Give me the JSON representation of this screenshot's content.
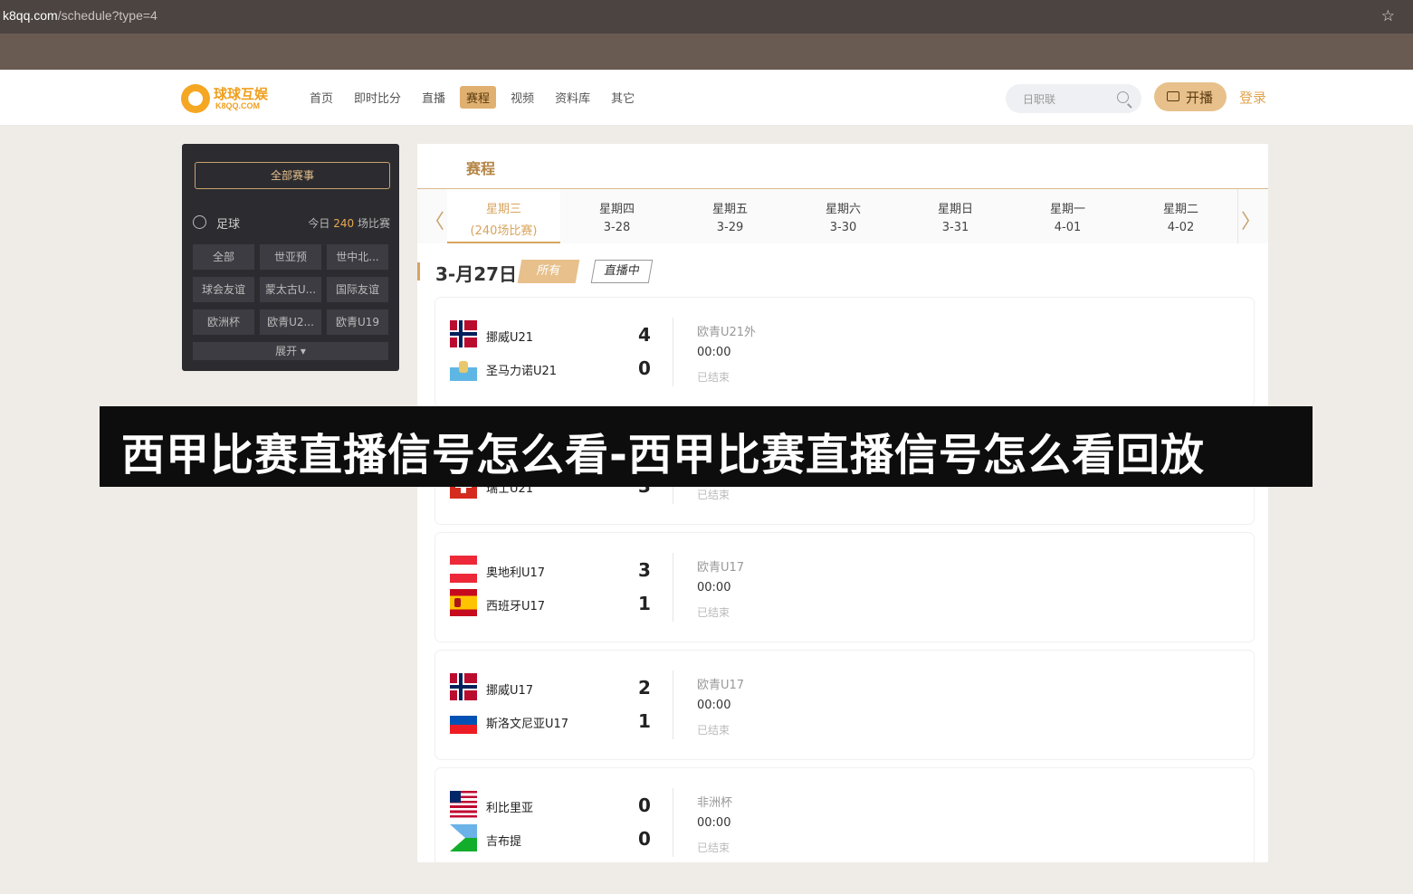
{
  "browser": {
    "url_host": "k8qq.com",
    "url_path": "/schedule?type=4"
  },
  "header": {
    "logo_name": "球球互娱",
    "logo_domain": "K8QQ.COM",
    "nav": [
      "首页",
      "即时比分",
      "直播",
      "赛程",
      "视频",
      "资料库",
      "其它"
    ],
    "nav_active": "赛程",
    "search_placeholder": "日职联",
    "live_button": "开播",
    "login": "登录"
  },
  "sidebar": {
    "all_events": "全部赛事",
    "sport": "足球",
    "today_prefix": "今日",
    "today_count": "240",
    "today_suffix": "场比赛",
    "categories": [
      "全部",
      "世亚预",
      "世中北...",
      "球会友谊",
      "蒙太古U...",
      "国际友谊",
      "欧洲杯",
      "欧青U2...",
      "欧青U19"
    ],
    "expand": "展开"
  },
  "main": {
    "title": "赛程",
    "days": [
      {
        "name": "星期三",
        "date": "(240场比赛)"
      },
      {
        "name": "星期四",
        "date": "3-28"
      },
      {
        "name": "星期五",
        "date": "3-29"
      },
      {
        "name": "星期六",
        "date": "3-30"
      },
      {
        "name": "星期日",
        "date": "3-31"
      },
      {
        "name": "星期一",
        "date": "4-01"
      },
      {
        "name": "星期二",
        "date": "4-02"
      }
    ],
    "date_heading": "3-月27日",
    "tag_all": "所有",
    "tag_live": "直播中",
    "matches": [
      {
        "home": "挪威U21",
        "home_score": "4",
        "away": "圣马力诺U21",
        "away_score": "0",
        "competition": "欧青U21外",
        "time": "00:00",
        "status": "已结束"
      },
      {
        "home": "",
        "home_score": "",
        "away": "瑞士U21",
        "away_score": "3",
        "competition": "",
        "time": "",
        "status": "已结束"
      },
      {
        "home": "奥地利U17",
        "home_score": "3",
        "away": "西班牙U17",
        "away_score": "1",
        "competition": "欧青U17",
        "time": "00:00",
        "status": "已结束"
      },
      {
        "home": "挪威U17",
        "home_score": "2",
        "away": "斯洛文尼亚U17",
        "away_score": "1",
        "competition": "欧青U17",
        "time": "00:00",
        "status": "已结束"
      },
      {
        "home": "利比里亚",
        "home_score": "0",
        "away": "吉布提",
        "away_score": "0",
        "competition": "非洲杯",
        "time": "00:00",
        "status": "已结束"
      }
    ]
  },
  "banner": {
    "text": "西甲比赛直播信号怎么看-西甲比赛直播信号怎么看回放"
  }
}
